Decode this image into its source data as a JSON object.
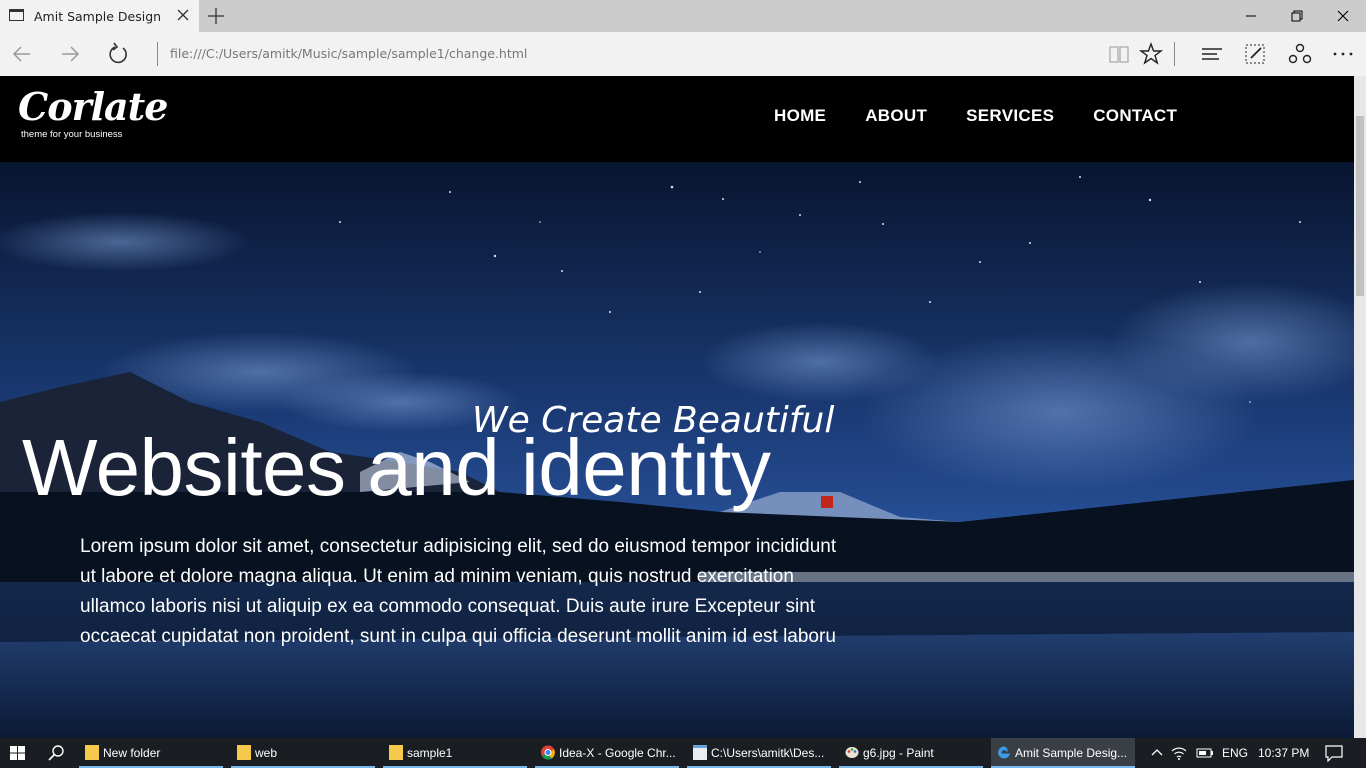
{
  "browser": {
    "tab_title": "Amit Sample Design",
    "url": "file:///C:/Users/amitk/Music/sample/sample1/change.html"
  },
  "site": {
    "logo": "Corlate",
    "tagline": "theme for your business",
    "nav": [
      "HOME",
      "ABOUT",
      "SERVICES",
      "CONTACT"
    ],
    "hero_sub": "We Create Beautiful",
    "hero_title": "Websites and identity",
    "hero_body": "Lorem ipsum dolor sit amet, consectetur adipisicing elit, sed do eiusmod tempor incididunt ut labore et dolore magna aliqua. Ut enim ad minim veniam, quis nostrud exercitation ullamco laboris nisi ut aliquip ex ea commodo consequat. Duis aute irure Excepteur sint occaecat cupidatat non proident, sunt in culpa qui officia deserunt mollit anim id est laboru",
    "accent_color": "#c0261d"
  },
  "taskbar": {
    "items": [
      {
        "label": "New folder",
        "icon": "folder-icon"
      },
      {
        "label": "web",
        "icon": "folder-icon"
      },
      {
        "label": "sample1",
        "icon": "folder-icon"
      },
      {
        "label": "Idea-X - Google Chr...",
        "icon": "chrome-icon"
      },
      {
        "label": "C:\\Users\\amitk\\Des...",
        "icon": "notepad-icon"
      },
      {
        "label": "g6.jpg - Paint",
        "icon": "paint-icon"
      },
      {
        "label": "Amit Sample Desig...",
        "icon": "edge-icon"
      }
    ],
    "language": "ENG",
    "clock": "10:37 PM"
  }
}
